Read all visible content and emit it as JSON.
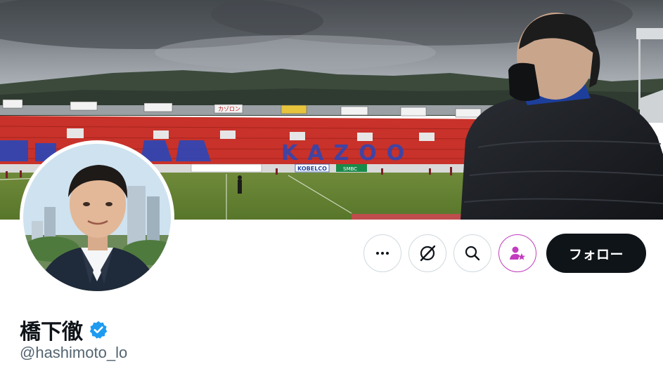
{
  "profile": {
    "display_name": "橋下徹",
    "handle": "@hashimoto_lo",
    "verified_icon": "verified-badge-icon"
  },
  "banner": {
    "billboards": [
      "KOBELCO",
      "SMBC"
    ],
    "stand_lettering": "KAZOO",
    "top_signs": [
      "カゾロン"
    ]
  },
  "actions": {
    "more_icon": "more-icon",
    "grok_icon": "grok-icon",
    "search_icon": "search-icon",
    "subscribe_icon": "subscribe-icon",
    "follow_label": "フォロー"
  },
  "colors": {
    "verified": "#1d9bf0",
    "follow_bg": "#0f1419",
    "subscribe": "#c13dbd",
    "handle": "#536471"
  }
}
